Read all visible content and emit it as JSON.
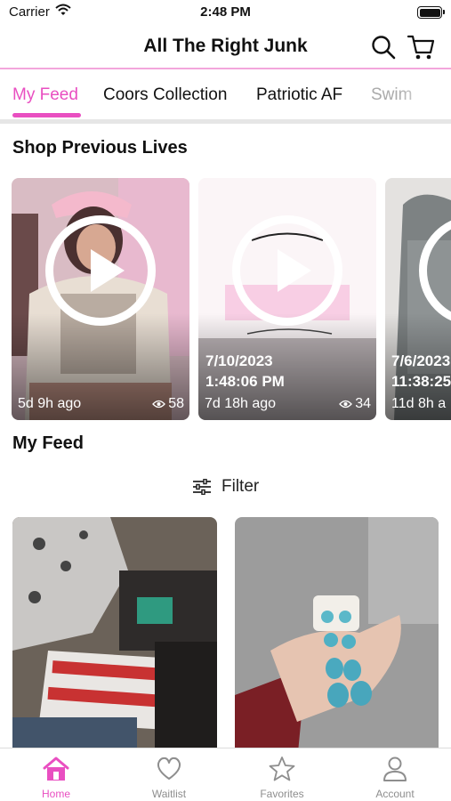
{
  "status_bar": {
    "carrier": "Carrier",
    "time": "2:48 PM"
  },
  "header": {
    "title": "All The Right Junk"
  },
  "tabs": [
    {
      "label": "My Feed",
      "active": true
    },
    {
      "label": "Coors Collection"
    },
    {
      "label": "Patriotic AF"
    },
    {
      "label": "Swim"
    }
  ],
  "lives_section": {
    "title": "Shop Previous Lives",
    "cards": [
      {
        "age": "5d 9h ago",
        "views": "58"
      },
      {
        "date": "7/10/2023",
        "time": "1:48:06 PM",
        "age": "7d 18h ago",
        "views": "34"
      },
      {
        "date": "7/6/2023",
        "time": "11:38:25",
        "age": "11d 8h a"
      }
    ]
  },
  "feed_section": {
    "title": "My Feed",
    "filter_label": "Filter"
  },
  "bottom_nav": [
    {
      "label": "Home",
      "icon": "home-icon",
      "active": true
    },
    {
      "label": "Waitlist",
      "icon": "heart-icon"
    },
    {
      "label": "Favorites",
      "icon": "star-icon"
    },
    {
      "label": "Account",
      "icon": "person-icon"
    }
  ],
  "colors": {
    "accent": "#e94fc1",
    "header_border": "#f3a6dc"
  }
}
